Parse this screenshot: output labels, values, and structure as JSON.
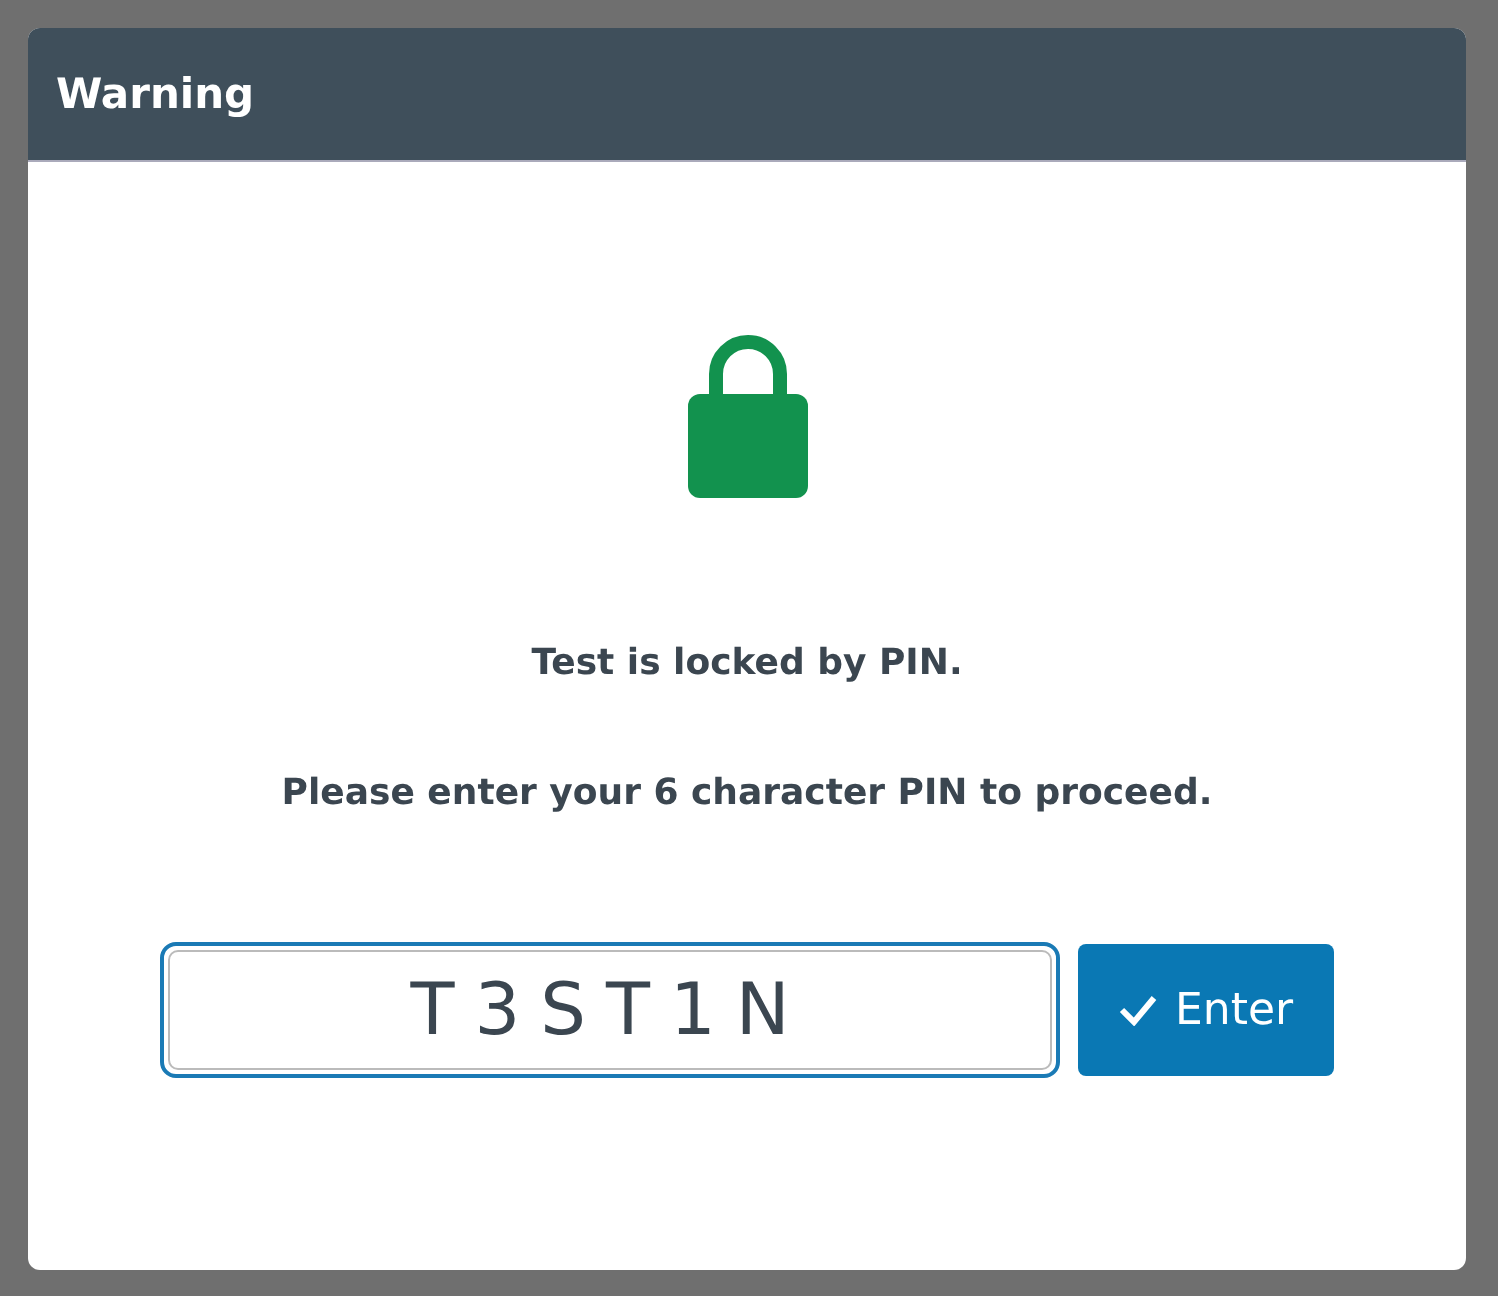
{
  "dialog": {
    "title": "Warning"
  },
  "message": "Test is locked by PIN.",
  "instruction": "Please enter your 6 character PIN to proceed.",
  "pin_field": {
    "value": "T3ST1N"
  },
  "submit_button": {
    "label": "Enter"
  }
}
